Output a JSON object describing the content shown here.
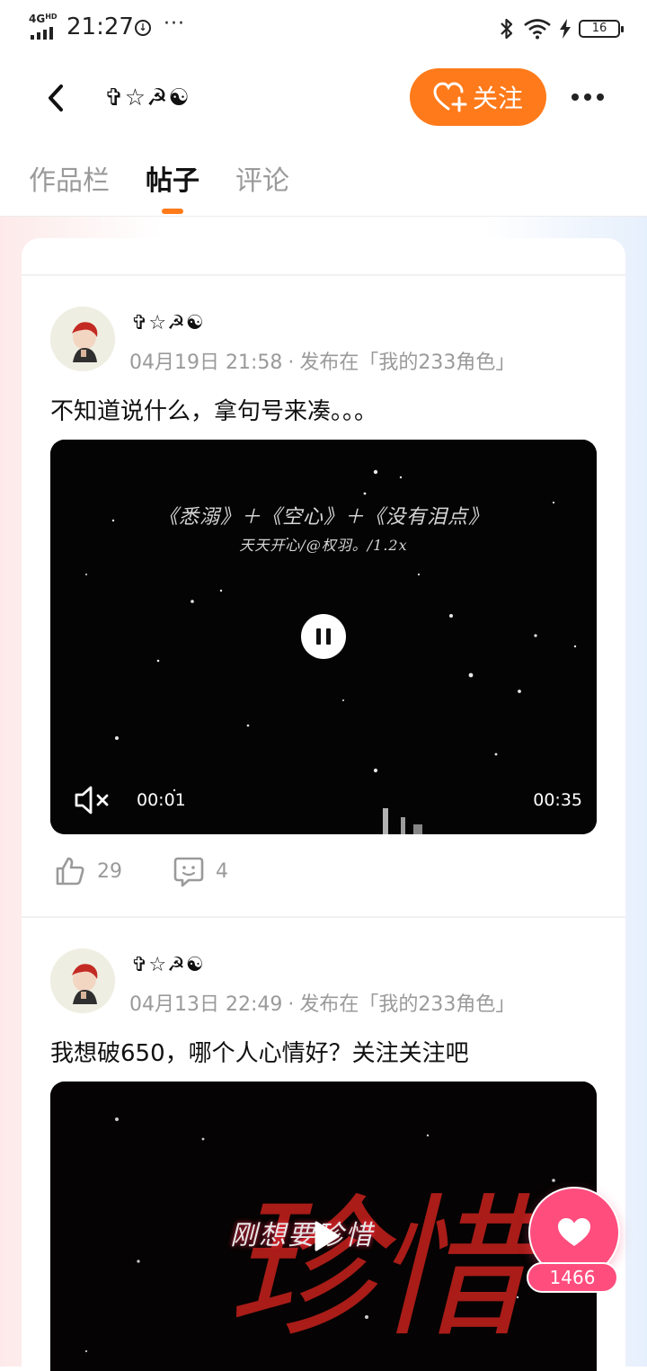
{
  "status_bar": {
    "network": "4G",
    "network_sup": "HD",
    "time": "21:27",
    "indicator_glyph": "↓",
    "dots": "···",
    "battery": "16",
    "icons": [
      "bluetooth-icon",
      "wifi-icon",
      "charging-icon",
      "battery-icon"
    ]
  },
  "header": {
    "back_icon": "chevron-left-icon",
    "title": "✞☆☭☯",
    "follow_label": "关注",
    "follow_icon": "heart-plus-icon",
    "more_icon": "more-icon",
    "accent_color": "#ff7a1a"
  },
  "tabs": [
    {
      "label": "作品栏",
      "active": false
    },
    {
      "label": "帖子",
      "active": true
    },
    {
      "label": "评论",
      "active": false
    }
  ],
  "posts": [
    {
      "author": "✞☆☭☯",
      "date": "04月19日 21:58",
      "dot": "·",
      "published_in": "发布在「我的233角色」",
      "text": "不知道说什么，拿句号来凑。。。",
      "video": {
        "overlay_line1": "《悉溺》＋《空心》＋《没有泪点》",
        "overlay_line2": "天天开心/@权羽。/1.2x",
        "state": "playing",
        "current_time": "00:01",
        "total_time": "00:35",
        "muted": true
      },
      "likes": "29",
      "comments": "4"
    },
    {
      "author": "✞☆☭☯",
      "date": "04月13日 22:49",
      "dot": "·",
      "published_in": "发布在「我的233角色」",
      "text": "我想破650，哪个人心情好？关注关注吧",
      "video": {
        "overlay_big": "珍惜",
        "overlay_small": "刚想要珍惜",
        "state": "paused"
      }
    }
  ],
  "floating_like": {
    "count": "1466",
    "color": "#ff4d7e"
  }
}
